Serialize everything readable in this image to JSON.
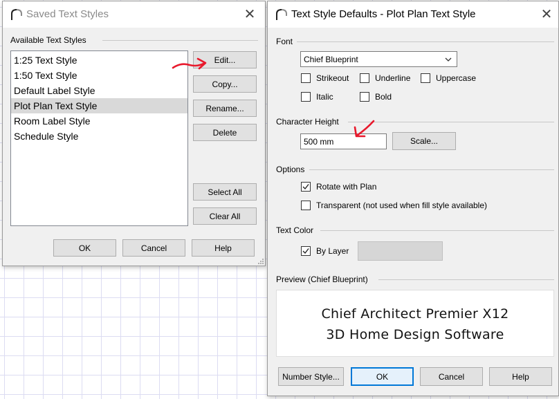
{
  "saved_dialog": {
    "title": "Saved Text Styles",
    "group_label": "Available Text Styles",
    "styles": [
      {
        "label": "1:25 Text Style",
        "selected": false
      },
      {
        "label": "1:50 Text Style",
        "selected": false
      },
      {
        "label": "Default Label Style",
        "selected": false
      },
      {
        "label": "Plot Plan Text Style",
        "selected": true
      },
      {
        "label": "Room Label Style",
        "selected": false
      },
      {
        "label": "Schedule Style",
        "selected": false
      }
    ],
    "buttons": {
      "edit": "Edit...",
      "copy": "Copy...",
      "rename": "Rename...",
      "delete": "Delete",
      "select_all": "Select All",
      "clear_all": "Clear All",
      "ok": "OK",
      "cancel": "Cancel",
      "help": "Help"
    }
  },
  "defaults_dialog": {
    "title": "Text Style Defaults - Plot Plan Text Style",
    "font": {
      "group_label": "Font",
      "selected": "Chief Blueprint",
      "checkboxes": {
        "strikeout": {
          "label": "Strikeout",
          "checked": false
        },
        "underline": {
          "label": "Underline",
          "checked": false
        },
        "uppercase": {
          "label": "Uppercase",
          "checked": false
        },
        "italic": {
          "label": "Italic",
          "checked": false
        },
        "bold": {
          "label": "Bold",
          "checked": false
        }
      }
    },
    "character_height": {
      "group_label": "Character Height",
      "value": "500 mm",
      "scale_button": "Scale..."
    },
    "options": {
      "group_label": "Options",
      "rotate_with_plan": {
        "label": "Rotate with Plan",
        "checked": true
      },
      "transparent": {
        "label": "Transparent (not used when fill style available)",
        "checked": false
      }
    },
    "text_color": {
      "group_label": "Text Color",
      "by_layer": {
        "label": "By Layer",
        "checked": true
      },
      "swatch_color": "#d6d6d6"
    },
    "preview": {
      "group_label": "Preview (Chief Blueprint)",
      "line1": "Chief Architect Premier X12",
      "line2": "3D Home Design Software"
    },
    "buttons": {
      "number_style": "Number Style...",
      "ok": "OK",
      "cancel": "Cancel",
      "help": "Help"
    }
  },
  "colors": {
    "annotation_arrow": "#e8192c",
    "focus_blue": "#0078d7",
    "selection_gray": "#d9d9d9"
  },
  "icons": {
    "app_icon": "chief-architect-arch-icon",
    "close": "close-icon",
    "check": "checkmark-icon",
    "dropdown": "chevron-down-icon"
  }
}
